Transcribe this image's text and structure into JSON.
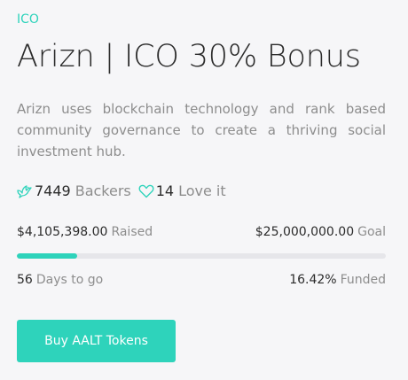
{
  "campaign": {
    "category": "ICO",
    "title": "Arizn | ICO 30% Bonus",
    "description": "Arizn uses blockchain technology and rank based community governance to create a thriving social investment hub."
  },
  "stats": {
    "backers_count": "7449",
    "backers_label": "Backers",
    "love_count": "14",
    "love_label": "Love it",
    "backers_icon": "dove-icon",
    "love_icon": "heart-icon"
  },
  "funding": {
    "raised_amount": "$4,105,398.00",
    "raised_label": "Raised",
    "goal_amount": "$25,000,000.00",
    "goal_label": "Goal",
    "progress_percent": 16.42,
    "days": "56",
    "days_label": "Days to go",
    "funded_percent": "16.42%",
    "funded_label": "Funded"
  },
  "cta": {
    "label": "Buy AALT Tokens"
  },
  "colors": {
    "accent": "#2ed3bb",
    "track": "#e6e6ea",
    "background": "#f6f6f8"
  }
}
